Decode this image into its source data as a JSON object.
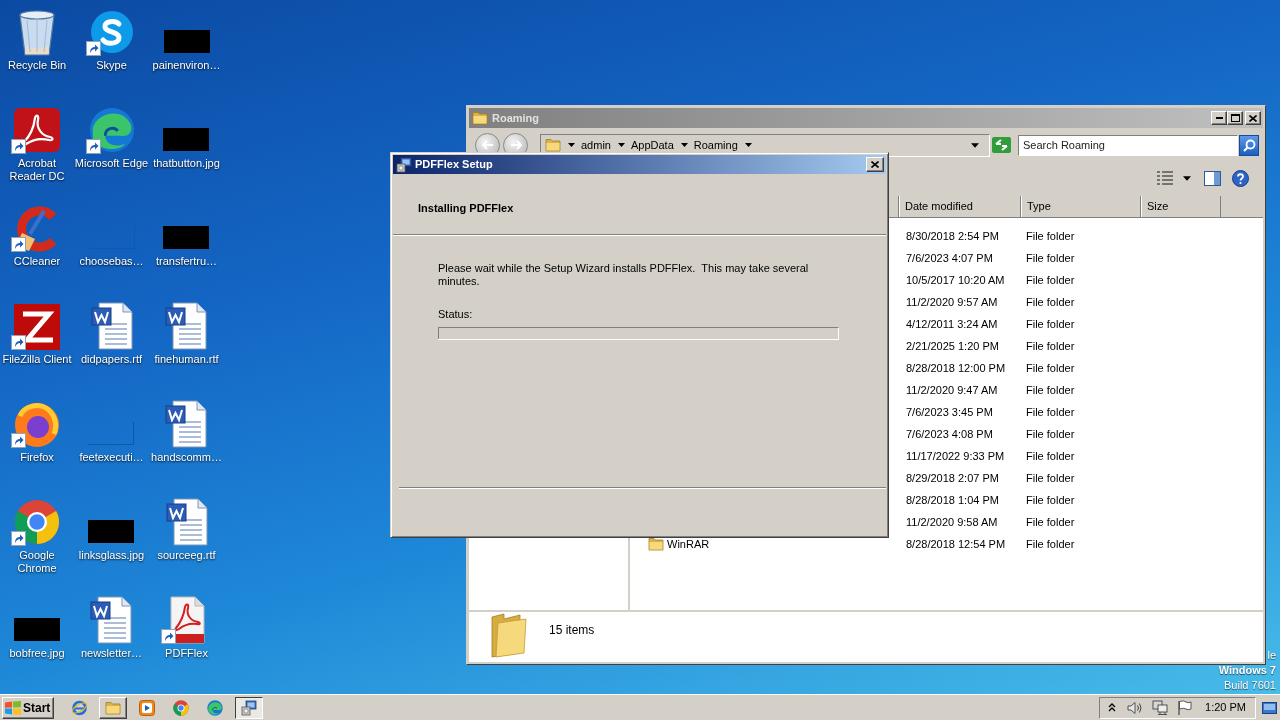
{
  "desktop": {
    "icons": [
      {
        "label": "Recycle Bin",
        "kind": "recycle-bin",
        "shortcut": false
      },
      {
        "label": "Acrobat Reader DC",
        "kind": "acrobat",
        "shortcut": true
      },
      {
        "label": "CCleaner",
        "kind": "ccleaner",
        "shortcut": true
      },
      {
        "label": "FileZilla Client",
        "kind": "filezilla",
        "shortcut": true
      },
      {
        "label": "Firefox",
        "kind": "firefox",
        "shortcut": true
      },
      {
        "label": "Google Chrome",
        "kind": "chrome",
        "shortcut": true
      },
      {
        "label": "bobfree.jpg",
        "kind": "image",
        "shortcut": false
      },
      {
        "label": "Skype",
        "kind": "skype",
        "shortcut": true
      },
      {
        "label": "Microsoft Edge",
        "kind": "edge",
        "shortcut": true
      },
      {
        "label": "choosebas…",
        "kind": "blank-image",
        "shortcut": false
      },
      {
        "label": "didpapers.rtf",
        "kind": "word-doc",
        "shortcut": false
      },
      {
        "label": "feetexecuti…",
        "kind": "blank-image",
        "shortcut": false
      },
      {
        "label": "linksglass.jpg",
        "kind": "image",
        "shortcut": false
      },
      {
        "label": "newsletter…",
        "kind": "word-doc",
        "shortcut": false
      },
      {
        "label": "painenviron…",
        "kind": "image",
        "shortcut": false
      },
      {
        "label": "thatbutton.jpg",
        "kind": "image",
        "shortcut": false
      },
      {
        "label": "transfertru…",
        "kind": "image",
        "shortcut": false
      },
      {
        "label": "finehuman.rtf",
        "kind": "word-doc",
        "shortcut": false
      },
      {
        "label": "handscomm…",
        "kind": "word-doc",
        "shortcut": false
      },
      {
        "label": "sourceeg.rtf",
        "kind": "word-doc",
        "shortcut": false
      },
      {
        "label": "PDFFlex",
        "kind": "pdf",
        "shortcut": true
      }
    ],
    "os_version": {
      "edition_fragment": "le",
      "product": "Windows 7",
      "build": "Build 7601"
    }
  },
  "explorer": {
    "title": "Roaming",
    "breadcrumb": [
      "admin",
      "AppData",
      "Roaming"
    ],
    "search": {
      "placeholder": "Search Roaming"
    },
    "columns": [
      "Date modified",
      "Type",
      "Size"
    ],
    "rows": [
      {
        "date_modified": "8/30/2018 2:54 PM",
        "type": "File folder"
      },
      {
        "date_modified": "7/6/2023 4:07 PM",
        "type": "File folder"
      },
      {
        "date_modified": "10/5/2017 10:20 AM",
        "type": "File folder"
      },
      {
        "date_modified": "11/2/2020 9:57 AM",
        "type": "File folder"
      },
      {
        "date_modified": "4/12/2011 3:24 AM",
        "type": "File folder"
      },
      {
        "date_modified": "2/21/2025 1:20 PM",
        "type": "File folder"
      },
      {
        "date_modified": "8/28/2018 12:00 PM",
        "type": "File folder"
      },
      {
        "date_modified": "11/2/2020 9:47 AM",
        "type": "File folder"
      },
      {
        "date_modified": "7/6/2023 3:45 PM",
        "type": "File folder"
      },
      {
        "date_modified": "7/6/2023 4:08 PM",
        "type": "File folder"
      },
      {
        "date_modified": "11/17/2022 9:33 PM",
        "type": "File folder"
      },
      {
        "date_modified": "8/29/2018 2:07 PM",
        "type": "File folder"
      },
      {
        "date_modified": "8/28/2018 1:04 PM",
        "type": "File folder"
      },
      {
        "date_modified": "11/2/2020 9:58 AM",
        "type": "File folder"
      },
      {
        "name": "WinRAR",
        "date_modified": "8/28/2018 12:54 PM",
        "type": "File folder"
      }
    ],
    "status": "15 items"
  },
  "setup_dialog": {
    "title": "PDFFlex Setup",
    "heading": "Installing PDFFlex",
    "message": "Please wait while the Setup Wizard installs PDFFlex.  This may take several minutes.",
    "status_label": "Status:",
    "progress": {
      "level": 0
    }
  },
  "taskbar": {
    "start": "Start",
    "apps": [
      {
        "kind": "ie",
        "running": false,
        "selected": false
      },
      {
        "kind": "explorer",
        "running": true,
        "selected": false
      },
      {
        "kind": "media-player",
        "running": false,
        "selected": false
      },
      {
        "kind": "chrome",
        "running": false,
        "selected": false
      },
      {
        "kind": "edge",
        "running": false,
        "selected": false
      },
      {
        "kind": "installer",
        "running": true,
        "selected": true
      }
    ],
    "clock": "1:20 PM"
  }
}
